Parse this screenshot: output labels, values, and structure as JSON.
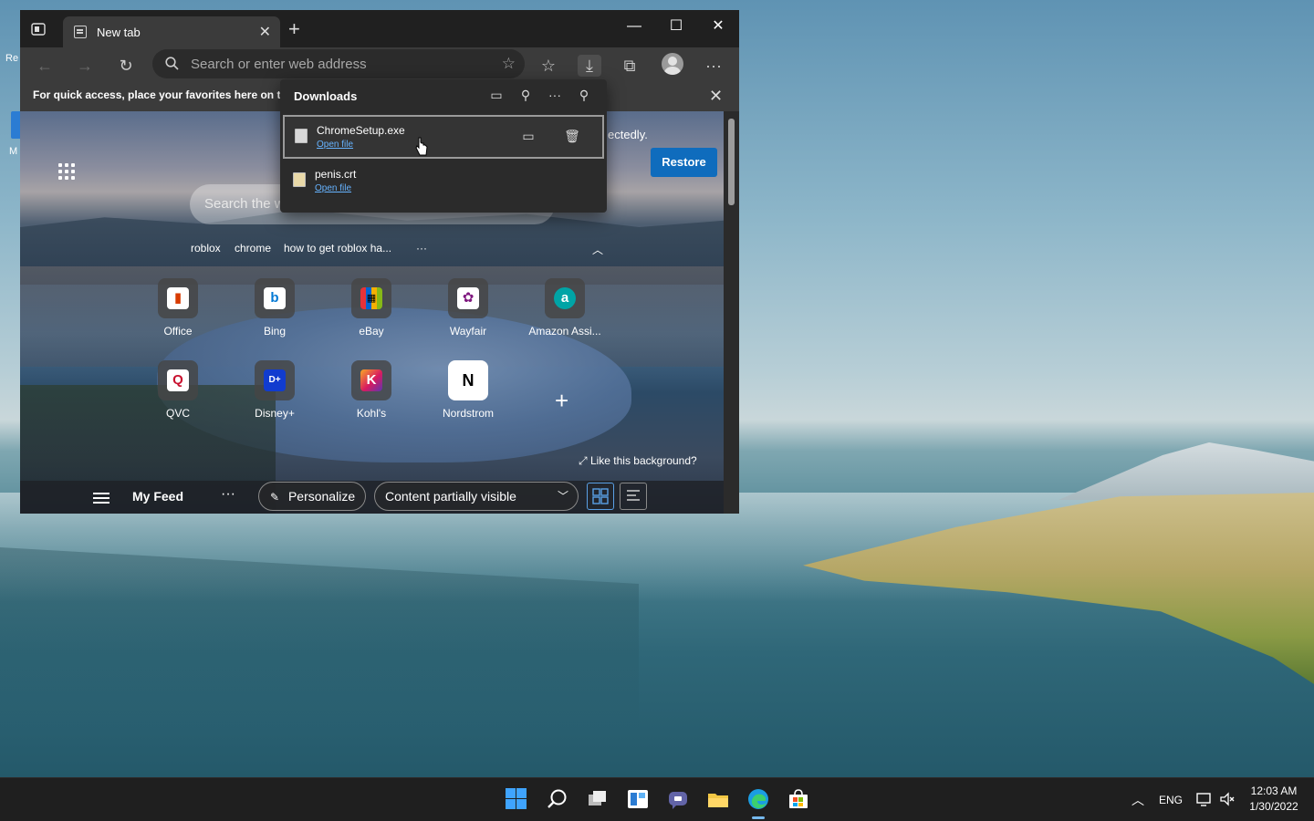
{
  "desktop": {
    "icon_label_1": "Re",
    "icon_label_2": "M"
  },
  "browser": {
    "tab": {
      "title": "New tab"
    },
    "address": {
      "placeholder": "Search or enter web address"
    },
    "favorites_bar_text": "For quick access, place your favorites here on the",
    "restore_message": "ectedly.",
    "restore_button": "Restore"
  },
  "downloads": {
    "title": "Downloads",
    "items": [
      {
        "name": "ChromeSetup.exe",
        "action": "Open file"
      },
      {
        "name": "penis.crt",
        "action": "Open file"
      }
    ]
  },
  "ntp": {
    "search_placeholder": "Search the w",
    "suggestions": [
      "roblox",
      "chrome",
      "how to get roblox ha..."
    ],
    "more": "···",
    "tiles": [
      {
        "label": "Office",
        "glyph": "▮",
        "color": "#d83b01"
      },
      {
        "label": "Bing",
        "glyph": "b",
        "color": "#0078d4"
      },
      {
        "label": "eBay",
        "glyph": "▦",
        "color": "#e53238"
      },
      {
        "label": "Wayfair",
        "glyph": "✿",
        "color": "#7f187f"
      },
      {
        "label": "Amazon Assi...",
        "glyph": "a",
        "color": "#00a4a6"
      },
      {
        "label": "QVC",
        "glyph": "Q",
        "color": "#c8102e"
      },
      {
        "label": "Disney+",
        "glyph": "D+",
        "color": "#113ccf"
      },
      {
        "label": "Kohl's",
        "glyph": "K",
        "color": "#8b1e3f"
      },
      {
        "label": "Nordstrom",
        "glyph": "N",
        "color": "#000000"
      }
    ],
    "add_tile": "+",
    "like_background": "Like this background?",
    "feed": {
      "title": "My Feed",
      "more": "···",
      "personalize": "Personalize",
      "content_visibility": "Content partially visible"
    }
  },
  "taskbar": {
    "language": "ENG",
    "time": "12:03 AM",
    "date": "1/30/2022"
  },
  "colors": {
    "accent": "#0f6cbd",
    "link": "#66b3ff",
    "taskbar_bg": "#1f1f1f"
  }
}
